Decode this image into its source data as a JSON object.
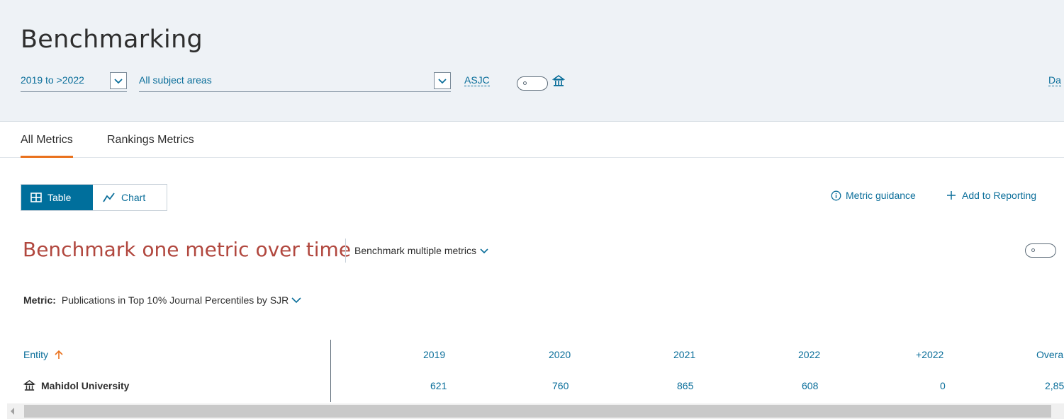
{
  "header": {
    "title": "Benchmarking",
    "date_range": "2019 to >2022",
    "subject_area": "All subject areas",
    "asjc_label": "ASJC",
    "data_link": "Da"
  },
  "tabs": [
    {
      "label": "All Metrics",
      "active": true
    },
    {
      "label": "Rankings Metrics",
      "active": false
    }
  ],
  "view_toggle": {
    "table_label": "Table",
    "chart_label": "Chart",
    "selected": "Table"
  },
  "actions": {
    "metric_guidance": "Metric guidance",
    "add_to_reporting": "Add to Reporting"
  },
  "benchmark": {
    "title": "Benchmark one metric over time",
    "multi_label": "Benchmark multiple metrics"
  },
  "metric": {
    "label": "Metric:",
    "value": "Publications in Top 10% Journal Percentiles by SJR"
  },
  "table": {
    "entity_header": "Entity",
    "columns": [
      "2019",
      "2020",
      "2021",
      "2022",
      "+2022",
      "Overa"
    ],
    "rows": [
      {
        "entity": "Mahidol University",
        "values": [
          "621",
          "760",
          "865",
          "608",
          "0",
          "2,85"
        ]
      }
    ]
  },
  "colors": {
    "accent_blue": "#006f9c",
    "link_blue": "#0a6e9a",
    "title_red": "#b1473e",
    "tab_orange": "#e9711c",
    "header_bg": "#eef2f6"
  }
}
